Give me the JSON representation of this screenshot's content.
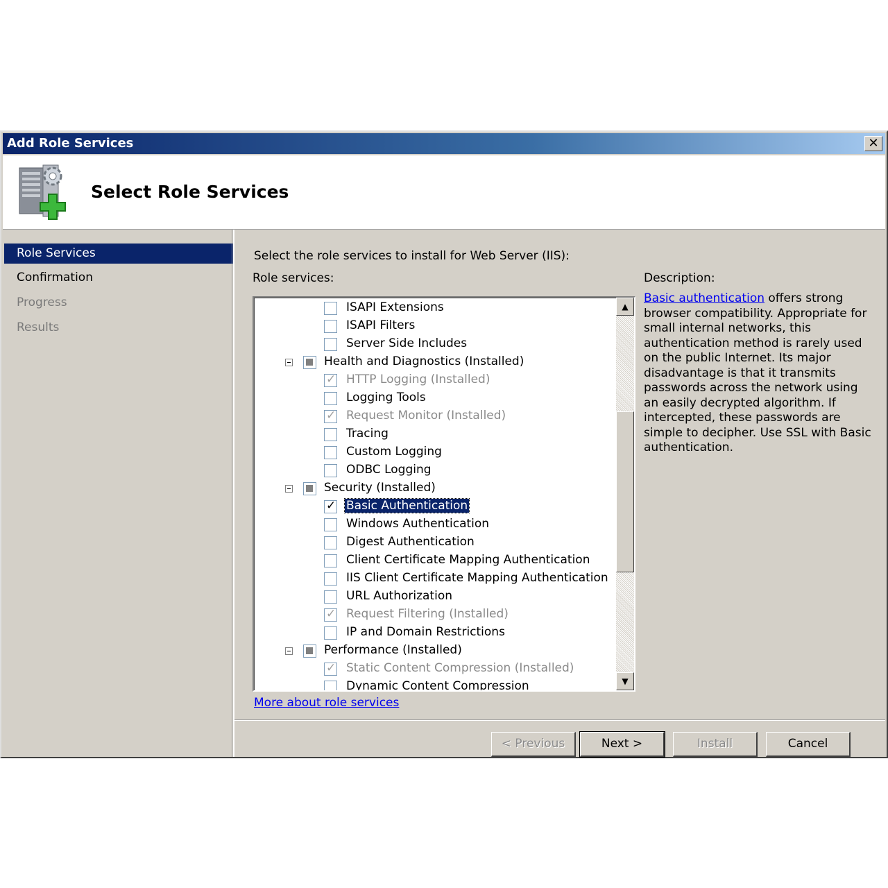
{
  "window": {
    "title": "Add Role Services"
  },
  "header": {
    "title": "Select Role Services"
  },
  "sidebar": {
    "items": [
      {
        "label": "Role Services"
      },
      {
        "label": "Confirmation"
      },
      {
        "label": "Progress"
      },
      {
        "label": "Results"
      }
    ]
  },
  "content": {
    "instruction": "Select the role services to install for Web Server (IIS):",
    "role_services_label": "Role services:",
    "description_label": "Description:",
    "description_link": "Basic authentication",
    "description_text": " offers strong browser compatibility. Appropriate for small internal networks, this authentication method is rarely used on the public Internet. Its major disadvantage is that it transmits passwords across the network using an easily decrypted algorithm. If intercepted, these passwords are simple to decipher. Use SSL with Basic authentication.",
    "more_link": "More about role services"
  },
  "tree": {
    "r0": "ISAPI Extensions",
    "r1": "ISAPI Filters",
    "r2": "Server Side Includes",
    "r3": "Health and Diagnostics  (Installed)",
    "r4": "HTTP Logging  (Installed)",
    "r5": "Logging Tools",
    "r6": "Request Monitor  (Installed)",
    "r7": "Tracing",
    "r8": "Custom Logging",
    "r9": "ODBC Logging",
    "r10": "Security  (Installed)",
    "r11": "Basic Authentication",
    "r12": "Windows Authentication",
    "r13": "Digest Authentication",
    "r14": "Client Certificate Mapping Authentication",
    "r15": "IIS Client Certificate Mapping Authentication",
    "r16": "URL Authorization",
    "r17": "Request Filtering  (Installed)",
    "r18": "IP and Domain Restrictions",
    "r19": "Performance  (Installed)",
    "r20": "Static Content Compression  (Installed)",
    "r21": "Dynamic Content Compression"
  },
  "buttons": {
    "previous": "< Previous",
    "next": "Next >",
    "install": "Install",
    "cancel": "Cancel"
  }
}
